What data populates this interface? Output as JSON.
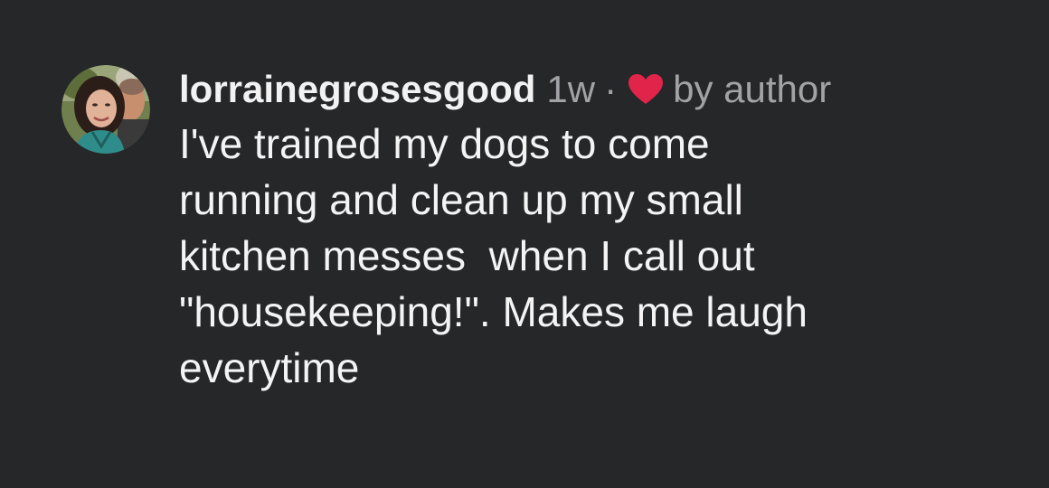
{
  "comment": {
    "username": "lorrainegrosesgood",
    "timestamp": "1w",
    "separator": "·",
    "liked_icon": "heart-icon",
    "liked_by": "by author",
    "text": "I've trained my dogs to come\nrunning and clean up my small\nkitchen messes  when I call out\n\"housekeeping!\". Makes me laugh\neverytime"
  },
  "colors": {
    "background": "#262729",
    "primary_text": "#f4f4f4",
    "secondary_text": "#a3a3a7",
    "heart": "#e0244a"
  }
}
